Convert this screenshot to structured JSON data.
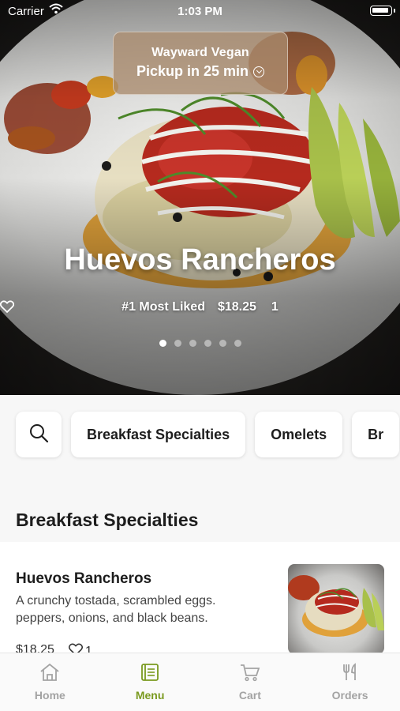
{
  "status_bar": {
    "carrier": "Carrier",
    "time": "1:03 PM"
  },
  "pickup": {
    "store": "Wayward Vegan",
    "time_text": "Pickup in 25 min"
  },
  "hero": {
    "title": "Huevos Rancheros",
    "rank": "#1 Most Liked",
    "price": "$18.25",
    "likes": "1",
    "pages": 6,
    "active_page": 1
  },
  "categories": [
    {
      "label": "Breakfast Specialties"
    },
    {
      "label": "Omelets"
    },
    {
      "label": "Br"
    }
  ],
  "section": {
    "title": "Breakfast Specialties"
  },
  "menu_items": [
    {
      "name": "Huevos Rancheros",
      "description": "A crunchy tostada, scrambled eggs. peppers, onions, and black beans.",
      "price": "$18.25",
      "likes": "1"
    }
  ],
  "tabs": [
    {
      "label": "Home",
      "icon": "home-icon"
    },
    {
      "label": "Menu",
      "icon": "menu-book-icon",
      "active": true
    },
    {
      "label": "Cart",
      "icon": "cart-icon"
    },
    {
      "label": "Orders",
      "icon": "fork-knife-icon"
    }
  ],
  "colors": {
    "accent": "#7a9a1f",
    "tab_inactive": "#a3a3a3"
  }
}
